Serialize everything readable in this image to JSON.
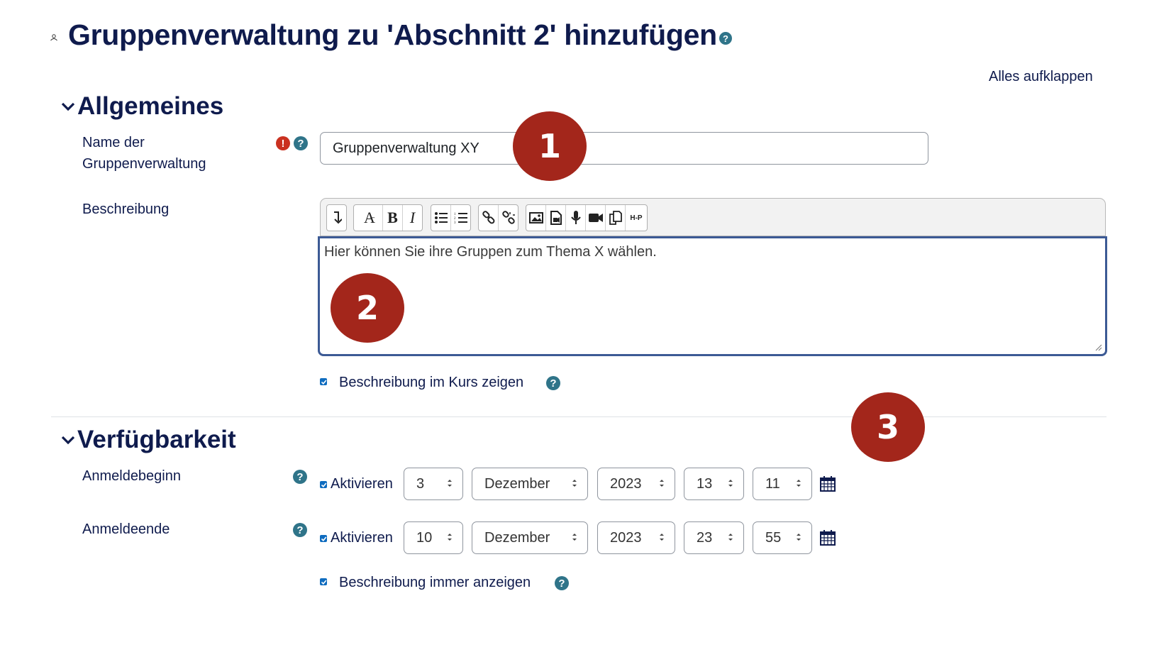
{
  "header": {
    "title": "Gruppenverwaltung zu 'Abschnitt 2' hinzufügen",
    "expand_all": "Alles aufklappen"
  },
  "general": {
    "section_title": "Allgemeines",
    "name_label_line1": "Name der",
    "name_label_line2": "Gruppenverwaltung",
    "name_value": "Gruppenverwaltung XY",
    "description_label": "Beschreibung",
    "description_text": "Hier können Sie ihre Gruppen zum Thema X wählen.",
    "show_in_course_label": "Beschreibung im Kurs zeigen",
    "show_in_course_checked": true
  },
  "toolbar": {
    "groups": [
      [
        "collapse-icon"
      ],
      [
        "font-style-icon",
        "bold-icon",
        "italic-icon"
      ],
      [
        "unordered-list-icon",
        "ordered-list-icon"
      ],
      [
        "link-icon",
        "unlink-icon"
      ],
      [
        "image-icon",
        "media-icon",
        "record-audio-icon",
        "record-video-icon",
        "manage-files-icon",
        "h5p-icon"
      ]
    ],
    "bold": "B",
    "italic": "I",
    "font_style": "A",
    "h5p": "H-P"
  },
  "availability": {
    "section_title": "Verfügbarkeit",
    "start": {
      "label": "Anmeldebeginn",
      "enable_label": "Aktivieren",
      "enabled": true,
      "day": "3",
      "month": "Dezember",
      "year": "2023",
      "hour": "13",
      "minute": "11"
    },
    "end": {
      "label": "Anmeldeende",
      "enable_label": "Aktivieren",
      "enabled": true,
      "day": "10",
      "month": "Dezember",
      "year": "2023",
      "hour": "23",
      "minute": "55"
    },
    "always_show_label": "Beschreibung immer anzeigen",
    "always_show_checked": true
  },
  "annotations": {
    "badge1": "1",
    "badge2": "2",
    "badge3": "3"
  },
  "colors": {
    "heading": "#0f1b4d",
    "help": "#2f7489",
    "required": "#ca3120",
    "badge": "#a3261b",
    "editor_border": "#3c5a95",
    "checkbox": "#0f6cbf"
  }
}
